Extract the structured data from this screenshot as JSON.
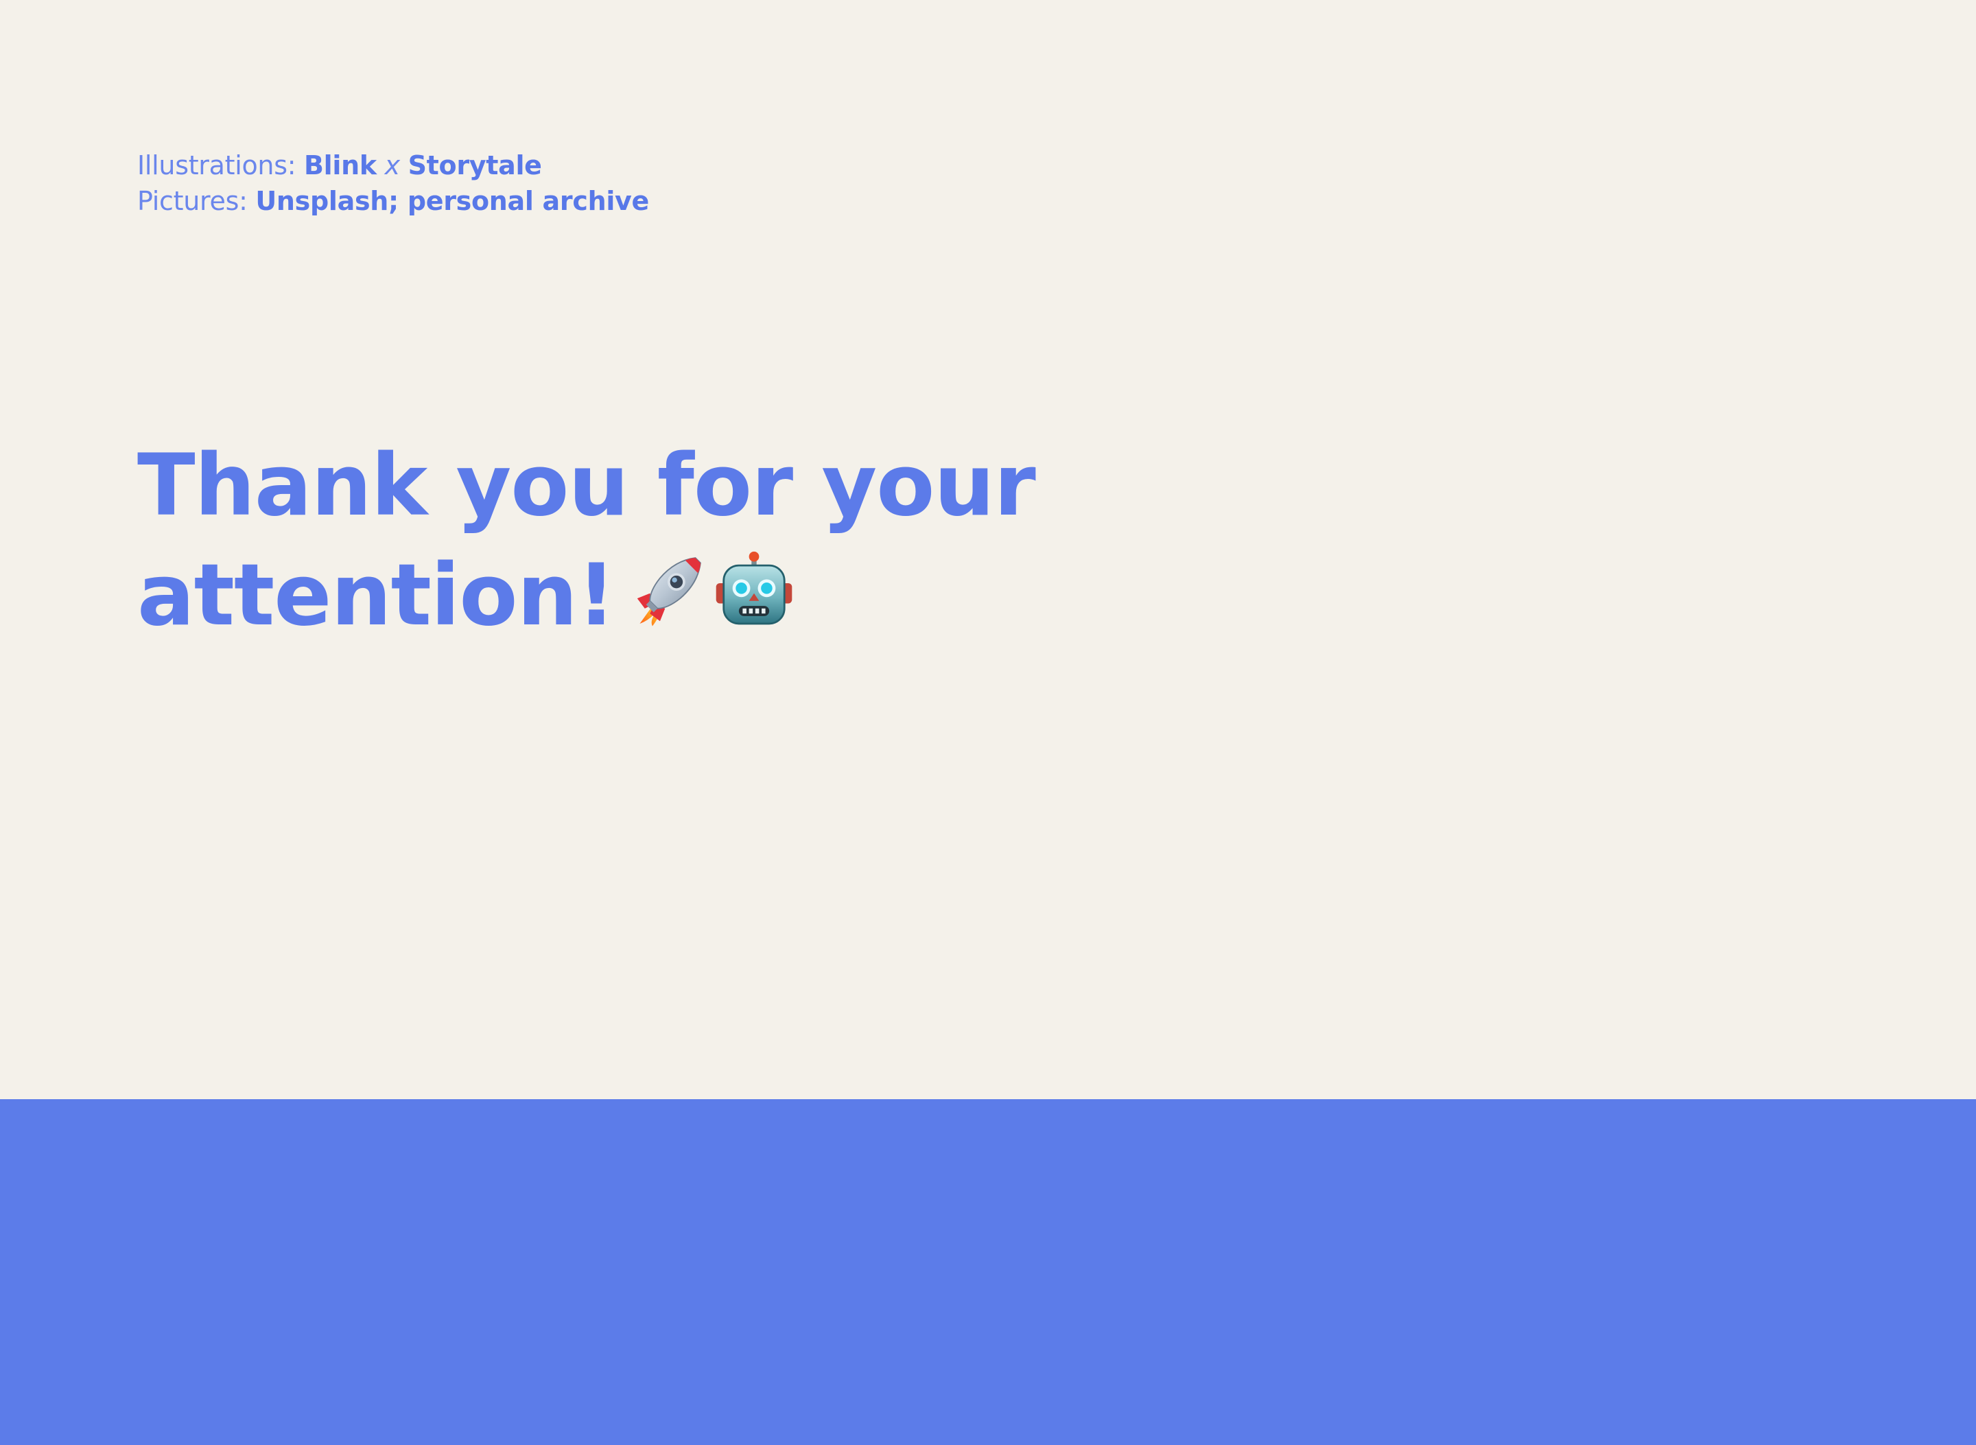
{
  "credits": {
    "illustrations_label": "Illustrations: ",
    "illustrations_part1": "Blink",
    "illustrations_sep": "x",
    "illustrations_part2": "Storytale",
    "pictures_label": "Pictures: ",
    "pictures_value": "Unsplash; personal archive"
  },
  "headline": {
    "line1": "Thank you for your",
    "line2": "attention!"
  },
  "icons": {
    "rocket": "rocket-icon",
    "robot": "robot-icon"
  },
  "colors": {
    "background": "#f4f1ea",
    "accent": "#5c7ce9"
  }
}
